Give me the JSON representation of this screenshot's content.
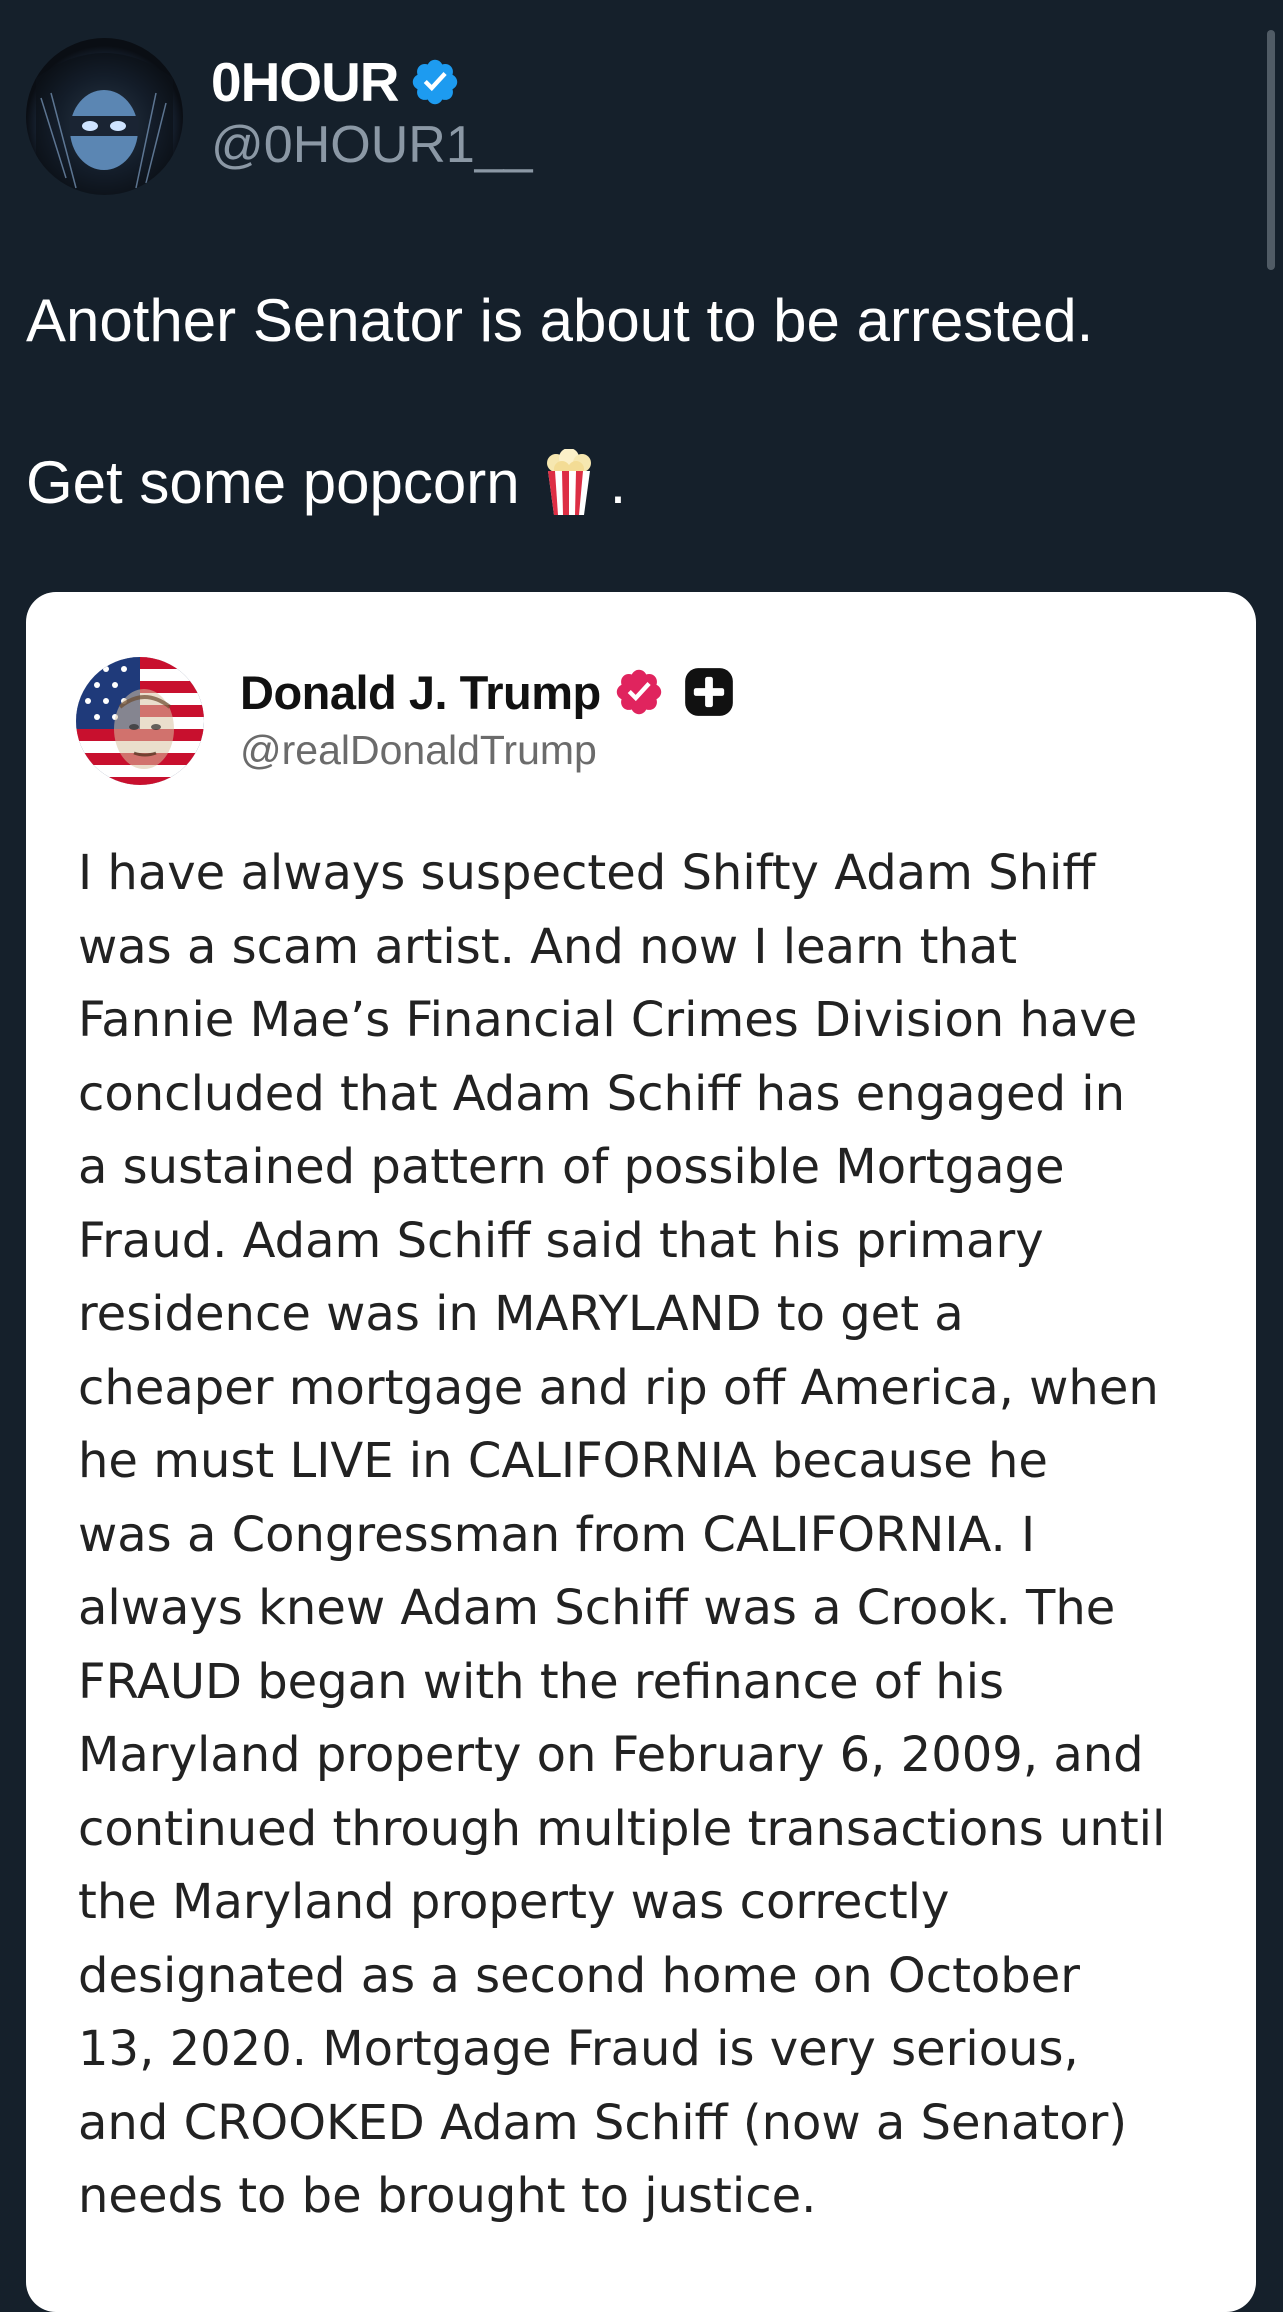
{
  "tweet": {
    "author": {
      "display_name": "0HOUR",
      "handle": "@0HOUR1__",
      "verified_icon": "verified-badge-icon",
      "avatar_icon": "hooded-figure-avatar"
    },
    "text_lines": [
      "Another Senator is about to be arrested.",
      "Get some popcorn",
      "."
    ],
    "emoji": "popcorn-icon"
  },
  "quoted_post": {
    "author": {
      "display_name": "Donald J. Trump",
      "handle": "@realDonaldTrump",
      "verified_icon": "verified-badge-icon",
      "extra_icon": "plus-badge-icon",
      "avatar_icon": "flag-portrait-avatar"
    },
    "body_lines": [
      "I have always suspected Shifty Adam Shiff",
      "was a scam artist. And now I learn that",
      "Fannie Mae’s Financial Crimes Division have",
      "concluded that Adam Schiff has engaged in",
      "a sustained pattern of possible Mortgage",
      "Fraud. Adam Schiff said that his primary",
      "residence was in MARYLAND to get a",
      "cheaper mortgage and rip off America, when",
      "he must LIVE in CALIFORNIA because he",
      "was a Congressman from CALIFORNIA. I",
      "always knew Adam Schiff was a Crook. The",
      "FRAUD began with the refinance of his",
      "Maryland property on February 6, 2009, and",
      "continued through multiple transactions until",
      "the Maryland property was correctly",
      "designated as a second home on October",
      "13, 2020. Mortgage Fraud is very serious,",
      "and CROOKED Adam Schiff (now a Senator)",
      "needs to be brought to justice."
    ]
  },
  "colors": {
    "background": "#15202b",
    "verified_blue": "#1d9bf0",
    "verified_red": "#e0245e",
    "handle_gray": "#8b98a5"
  }
}
